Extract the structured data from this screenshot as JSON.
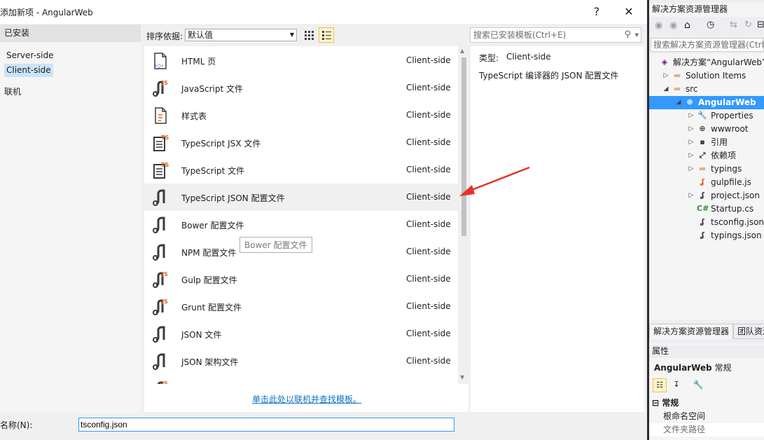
{
  "dialog": {
    "title": "添加新项 - AngularWeb",
    "help_label": "?",
    "close_label": "✕"
  },
  "left_pane": {
    "installed_label": "已安装",
    "items": [
      {
        "label": "Server-side",
        "selected": false
      },
      {
        "label": "Client-side",
        "selected": true
      }
    ],
    "online_label": "联机"
  },
  "toolbar": {
    "sort_label": "排序依据:",
    "sort_value": "默认值"
  },
  "search": {
    "placeholder": "搜索已安装模板(Ctrl+E)"
  },
  "templates": [
    {
      "name": "HTML 页",
      "category": "Client-side",
      "icon": "html-file-icon"
    },
    {
      "name": "JavaScript 文件",
      "category": "Client-side",
      "icon": "js-file-icon"
    },
    {
      "name": "样式表",
      "category": "Client-side",
      "icon": "css-file-icon"
    },
    {
      "name": "TypeScript JSX 文件",
      "category": "Client-side",
      "icon": "ts-file-icon"
    },
    {
      "name": "TypeScript 文件",
      "category": "Client-side",
      "icon": "ts-file-icon"
    },
    {
      "name": "TypeScript JSON 配置文件",
      "category": "Client-side",
      "icon": "json-config-icon",
      "selected": true
    },
    {
      "name": "Bower 配置文件",
      "category": "Client-side",
      "icon": "json-config-icon"
    },
    {
      "name": "NPM 配置文件",
      "category": "Client-side",
      "icon": "json-config-icon"
    },
    {
      "name": "Gulp 配置文件",
      "category": "Client-side",
      "icon": "js-config-icon"
    },
    {
      "name": "Grunt 配置文件",
      "category": "Client-side",
      "icon": "js-config-icon"
    },
    {
      "name": "JSON 文件",
      "category": "Client-side",
      "icon": "json-file-icon"
    },
    {
      "name": "JSON 架构文件",
      "category": "Client-side",
      "icon": "json-file-icon"
    }
  ],
  "tooltip": "Bower 配置文件",
  "find_link": "单击此处以联机并查找模板。",
  "detail": {
    "type_label": "类型:",
    "type_value": "Client-side",
    "description": "TypeScript 编译器的 JSON 配置文件"
  },
  "name_field": {
    "label": "名称(N):",
    "value": "tsconfig.json"
  },
  "solution_explorer": {
    "title": "解决方案资源管理器",
    "search_placeholder": "搜索解决方案资源管理器(Ctrl",
    "tree": [
      {
        "label": "解决方案“AngularWeb”",
        "level": 0,
        "expander": "",
        "icon": "solution-icon"
      },
      {
        "label": "Solution Items",
        "level": 1,
        "expander": "▷",
        "icon": "folder-icon"
      },
      {
        "label": "src",
        "level": 1,
        "expander": "◢",
        "icon": "folder-icon"
      },
      {
        "label": "AngularWeb",
        "level": 2,
        "expander": "◢",
        "icon": "web-project-icon",
        "selected": true
      },
      {
        "label": "Properties",
        "level": 3,
        "expander": "▷",
        "icon": "wrench-icon"
      },
      {
        "label": "wwwroot",
        "level": 3,
        "expander": "▷",
        "icon": "globe-icon"
      },
      {
        "label": "引用",
        "level": 3,
        "expander": "▷",
        "icon": "references-icon"
      },
      {
        "label": "依赖项",
        "level": 3,
        "expander": "▷",
        "icon": "dependencies-icon"
      },
      {
        "label": "typings",
        "level": 3,
        "expander": "▷",
        "icon": "folder-icon"
      },
      {
        "label": "gulpfile.js",
        "level": 3,
        "expander": "",
        "icon": "js-file-icon"
      },
      {
        "label": "project.json",
        "level": 3,
        "expander": "▷",
        "icon": "json-file-icon"
      },
      {
        "label": "Startup.cs",
        "level": 3,
        "expander": "",
        "icon": "csharp-icon"
      },
      {
        "label": "tsconfig.json",
        "level": 3,
        "expander": "",
        "icon": "json-file-icon"
      },
      {
        "label": "typings.json",
        "level": 3,
        "expander": "",
        "icon": "json-file-icon"
      }
    ],
    "tabs": [
      "解决方案资源管理器",
      "团队资源"
    ]
  },
  "properties": {
    "title": "属性",
    "object_name": "AngularWeb",
    "object_type": "常规",
    "section": "常规",
    "rows": [
      "根命名空间",
      "文件夹路径"
    ]
  },
  "colors": {
    "accent": "#3399ff",
    "link": "#0e70c0",
    "arrow": "#e8312d"
  }
}
